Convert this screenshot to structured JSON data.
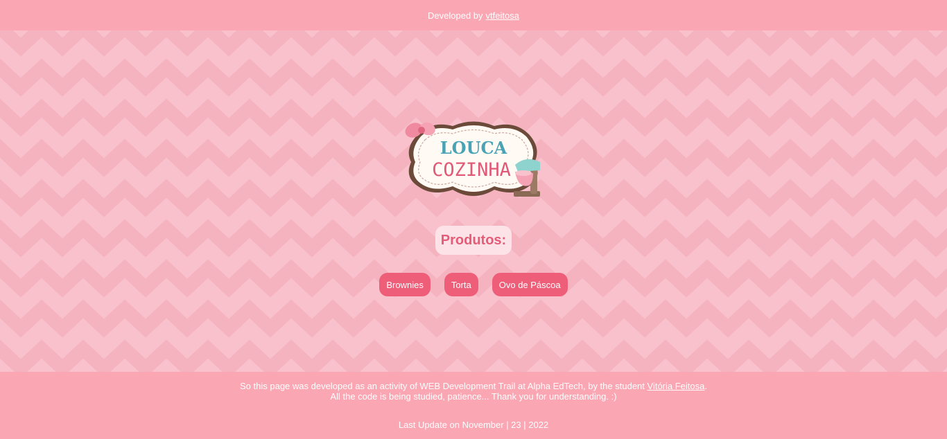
{
  "header": {
    "prefix": "Developed by",
    "link_text": "vtfeitosa"
  },
  "logo": {
    "line1": "LOUCA",
    "line2": "COZINHA"
  },
  "produtos": {
    "title": "Produtos:"
  },
  "products": [
    {
      "label": "Brownies"
    },
    {
      "label": "Torta"
    },
    {
      "label": "Ovo de Páscoa"
    }
  ],
  "footer": {
    "note_before": "So this page was developed as an activity of WEB Development Trail at Alpha EdTech, by the student ",
    "note_link": "Vitória Feitosa",
    "note_after": ".",
    "note_line2": "All the code is being studied, patience... Thank you for understanding. :)",
    "last_update": "Last Update on November | 23 | 2022"
  },
  "colors": {
    "bar": "#fba6b3",
    "background": "#f8c1cc",
    "chevron": "#f5b3c0",
    "button": "#ee5e78",
    "title_text": "#e45c77",
    "logo_teal": "#4aa3b4",
    "logo_pink": "#e05a78"
  },
  "icons": [
    "mixer-icon",
    "bow-icon"
  ]
}
